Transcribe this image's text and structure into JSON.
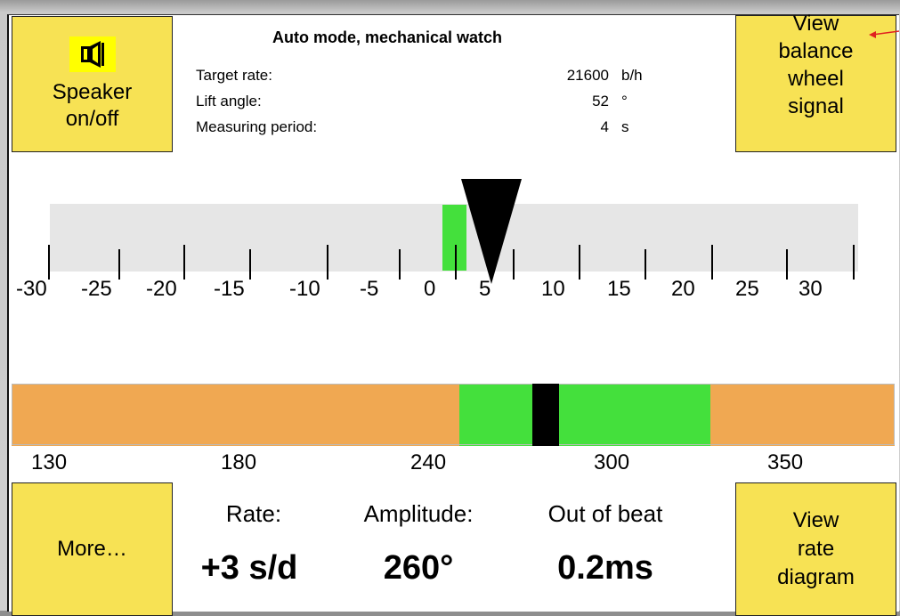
{
  "header": {
    "title": "Auto mode, mechanical watch",
    "rows": [
      {
        "label": "Target rate:",
        "value": "21600",
        "unit": "b/h"
      },
      {
        "label": "Lift angle:",
        "value": "52",
        "unit": "°"
      },
      {
        "label": "Measuring period:",
        "value": "4",
        "unit": "s"
      }
    ]
  },
  "buttons": {
    "speaker_line1": "Speaker",
    "speaker_line2": "on/off",
    "balance_line1": "View",
    "balance_line2": "balance",
    "balance_line3": "wheel",
    "balance_line4": "signal",
    "more": "More…",
    "rate_line1": "View",
    "rate_line2": "rate",
    "rate_line3": "diagram"
  },
  "rate_scale": {
    "labels": [
      "-30",
      "-25",
      "-20",
      "-15",
      "-10",
      "-5",
      "0",
      "5",
      "10",
      "15",
      "20",
      "25",
      "30"
    ],
    "current_rate": 3,
    "indicator_color": "#44e03c"
  },
  "amplitude_scale": {
    "labels": [
      "130",
      "180",
      "240",
      "300",
      "350"
    ],
    "current_amplitude": 260,
    "good_range_color": "#44e03c",
    "bad_range_color": "#f0a852",
    "marker_color": "#000000"
  },
  "stats": {
    "rate_label": "Rate:",
    "rate_value": "+3 s/d",
    "amplitude_label": "Amplitude:",
    "amplitude_value": "260°",
    "beat_label": "Out of beat",
    "beat_value": "0.2ms"
  },
  "colors": {
    "button_yellow": "#f7e254",
    "scale_bg": "#e6e6e6",
    "speaker_icon_bg": "#ffff00"
  }
}
